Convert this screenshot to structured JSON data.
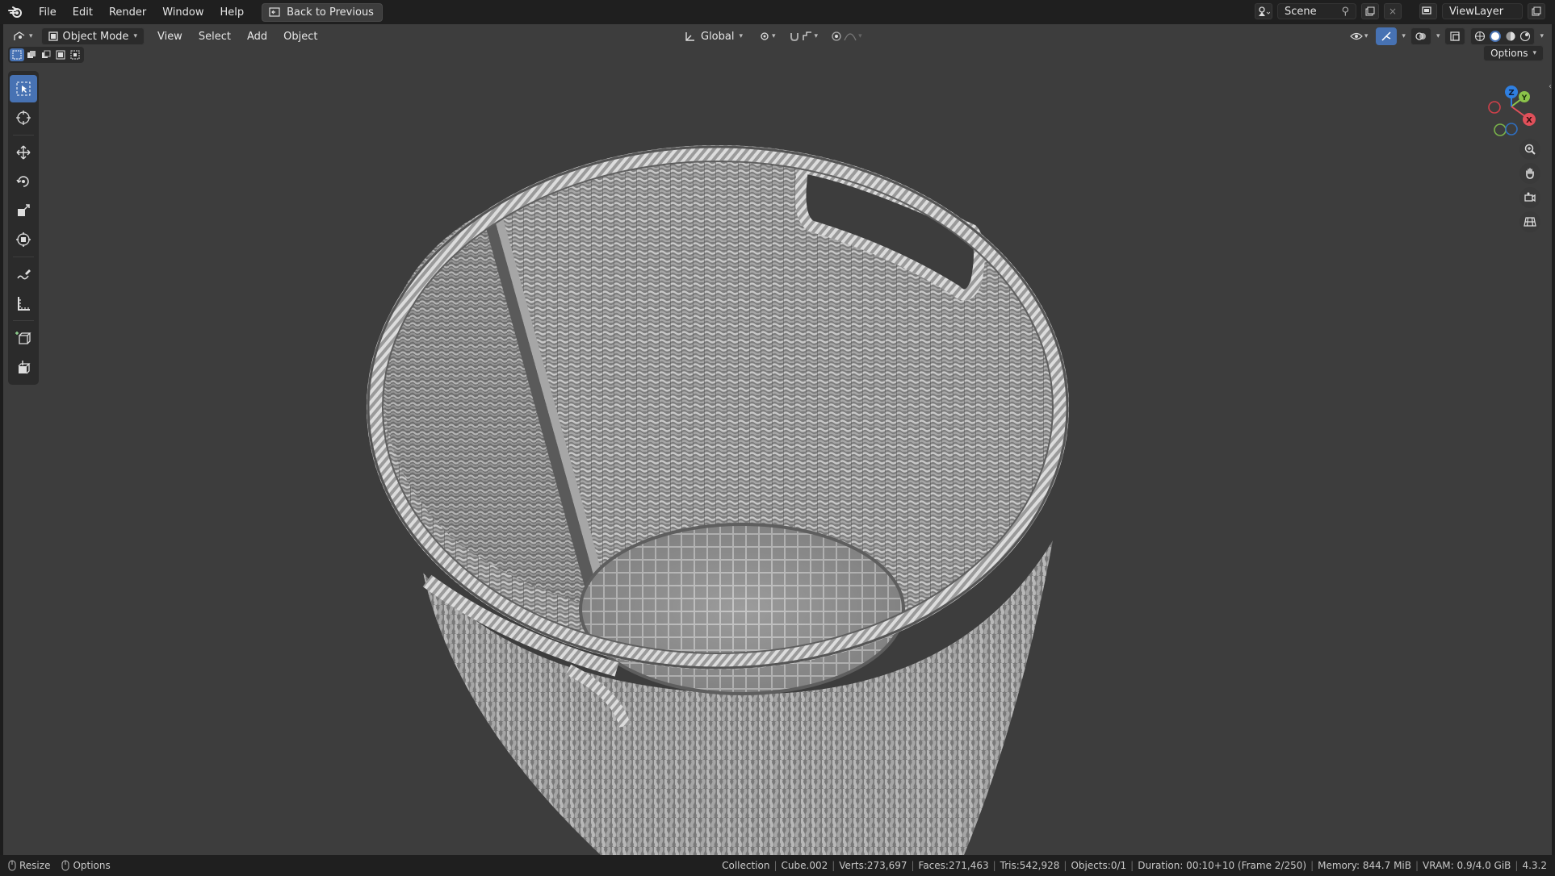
{
  "topbar": {
    "menus": [
      "File",
      "Edit",
      "Render",
      "Window",
      "Help"
    ],
    "back_button": "Back to Previous",
    "scene": "Scene",
    "view_layer": "ViewLayer"
  },
  "viewport_header": {
    "mode": "Object Mode",
    "menus": [
      "View",
      "Select",
      "Add",
      "Object"
    ],
    "orientation": "Global",
    "options": "Options"
  },
  "gizmo": {
    "axes": [
      "X",
      "Y",
      "Z"
    ]
  },
  "tools": [
    "select-box",
    "cursor",
    "move",
    "rotate",
    "scale",
    "transform",
    "annotate",
    "measure",
    "add-cube",
    "extrude"
  ],
  "statusbar": {
    "left": {
      "resize": "Resize",
      "options": "Options"
    },
    "collection": "Collection",
    "object": "Cube.002",
    "verts": "Verts:273,697",
    "faces": "Faces:271,463",
    "tris": "Tris:542,928",
    "objects": "Objects:0/1",
    "duration": "Duration: 00:10+10 (Frame 2/250)",
    "memory": "Memory: 844.7 MiB",
    "vram": "VRAM: 0.9/4.0 GiB",
    "version": "4.3.2"
  }
}
